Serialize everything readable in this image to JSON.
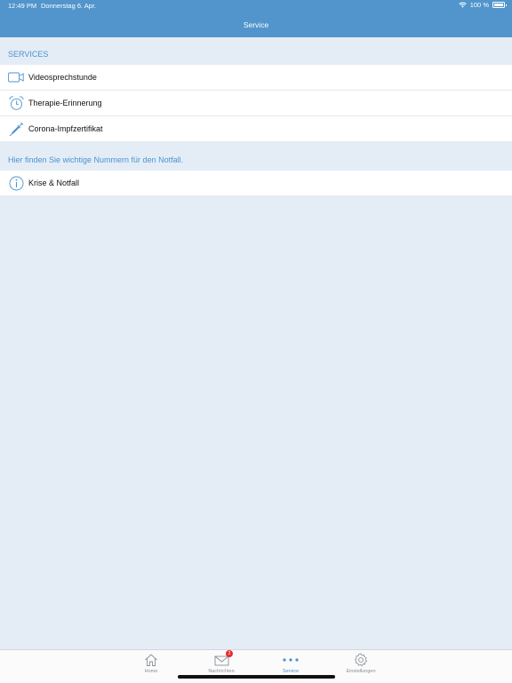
{
  "status": {
    "time": "12:49 PM",
    "date": "Donnerstag 6. Apr.",
    "battery": "100 %"
  },
  "nav": {
    "title": "Service"
  },
  "services": {
    "header": "SERVICES",
    "items": [
      {
        "label": "Videosprechstunde",
        "icon": "video-camera-icon"
      },
      {
        "label": "Therapie-Erinnerung",
        "icon": "alarm-clock-icon"
      },
      {
        "label": "Corona-Impfzertifikat",
        "icon": "syringe-icon"
      }
    ]
  },
  "emergency": {
    "header": "Hier finden Sie wichtige Nummern für den Notfall.",
    "items": [
      {
        "label": "Krise & Notfall",
        "icon": "info-circle-icon"
      }
    ]
  },
  "tabbar": {
    "tabs": [
      {
        "label": "Home",
        "icon": "house-icon"
      },
      {
        "label": "Nachrichten",
        "icon": "envelope-icon",
        "badge": "2"
      },
      {
        "label": "Service",
        "icon": "more-dots-icon",
        "active": true
      },
      {
        "label": "Einstellungen",
        "icon": "gear-icon"
      }
    ]
  },
  "colors": {
    "header": "#5195cc",
    "accent": "#4c93cf",
    "background": "#e4edf6",
    "badge": "#e62c2c"
  }
}
